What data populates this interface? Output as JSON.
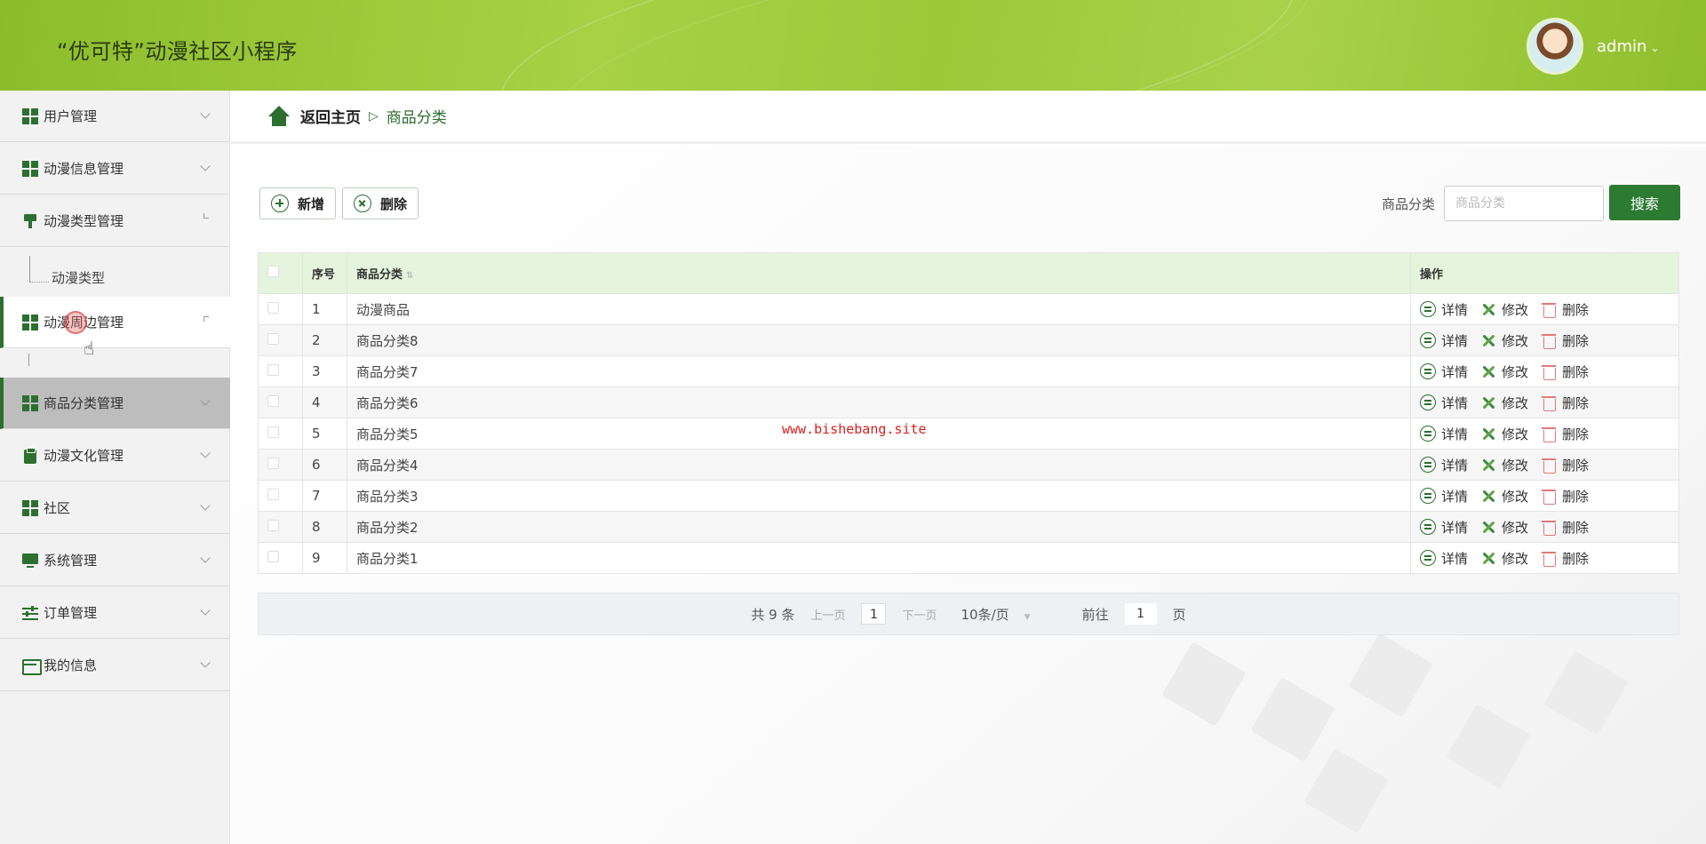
{
  "header": {
    "title": "“优可特”动漫社区小程序",
    "user": "admin",
    "user_chevron": "⌄"
  },
  "sidebar": {
    "items": [
      {
        "label": "用户管理"
      },
      {
        "label": "动漫信息管理"
      },
      {
        "label": "动漫类型管理"
      },
      {
        "label": "动漫周边管理"
      },
      {
        "label": "商品分类管理"
      },
      {
        "label": "动漫文化管理"
      },
      {
        "label": "社区"
      },
      {
        "label": "系统管理"
      },
      {
        "label": "订单管理"
      },
      {
        "label": "我的信息"
      }
    ],
    "sub_item": "动漫类型"
  },
  "breadcrumb": {
    "home": "返回主页",
    "separator": "▷",
    "current": "商品分类"
  },
  "toolbar": {
    "add": "新增",
    "delete": "删除",
    "search_label": "商品分类",
    "search_placeholder": "商品分类",
    "search_button": "搜索"
  },
  "table": {
    "headers": {
      "index": "序号",
      "category": "商品分类",
      "ops": "操作"
    },
    "ops": {
      "detail": "详情",
      "edit": "修改",
      "delete": "删除"
    },
    "rows": [
      {
        "index": "1",
        "category": "动漫商品"
      },
      {
        "index": "2",
        "category": "商品分类8"
      },
      {
        "index": "3",
        "category": "商品分类7"
      },
      {
        "index": "4",
        "category": "商品分类6"
      },
      {
        "index": "5",
        "category": "商品分类5"
      },
      {
        "index": "6",
        "category": "商品分类4"
      },
      {
        "index": "7",
        "category": "商品分类3"
      },
      {
        "index": "8",
        "category": "商品分类2"
      },
      {
        "index": "9",
        "category": "商品分类1"
      }
    ]
  },
  "watermark": "www.bishebang.site",
  "pager": {
    "total": "共 9 条",
    "prev": "上一页",
    "page": "1",
    "next": "下一页",
    "size": "10条/页",
    "goto": "前往",
    "goto_page": "1",
    "page_unit": "页"
  },
  "colors": {
    "brand": "#2d6e31",
    "header": "#a8d146",
    "button": "#2d7a32",
    "watermark": "#d91e1e"
  }
}
